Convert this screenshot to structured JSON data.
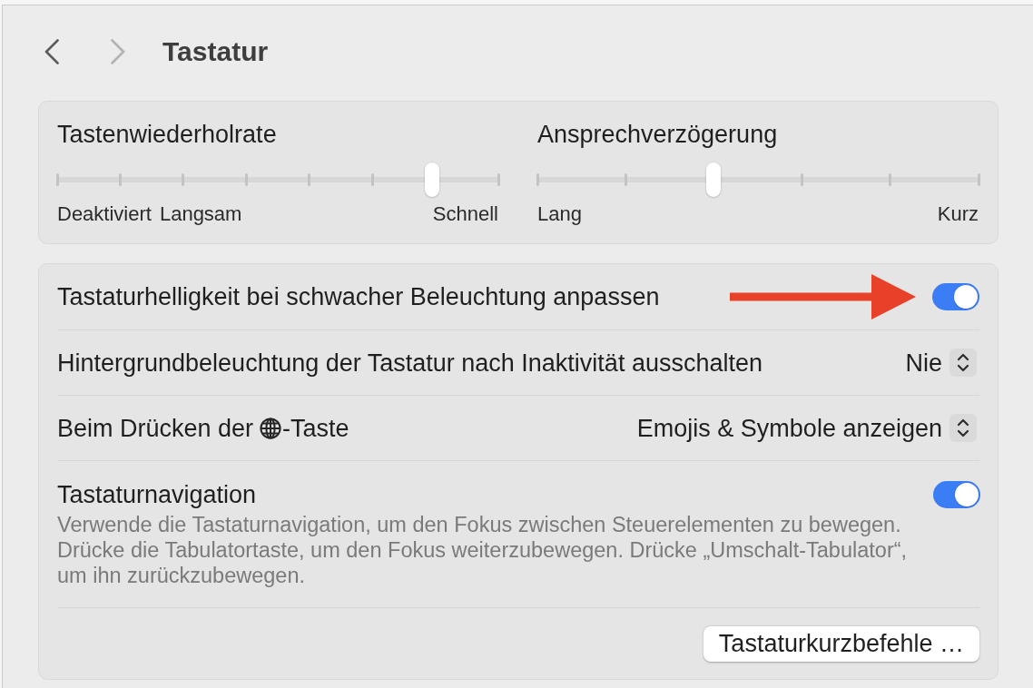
{
  "nav_buttons": [
    {
      "kind": "back",
      "disabled": false
    },
    {
      "kind": "forward",
      "disabled": true
    }
  ],
  "header": {
    "title": "Tastatur"
  },
  "sliders": [
    {
      "label": "Tastenwiederholrate",
      "level": 0.85,
      "min_labels": [
        "Deaktiviert",
        "Langsam"
      ],
      "max_labels": [
        "Schnell"
      ]
    },
    {
      "label": "Ansprechverzögerung",
      "level": 0.4,
      "min_labels": [
        "Lang"
      ],
      "max_labels": [
        "Kurz"
      ]
    }
  ],
  "settings": [
    {
      "kind": "toggle",
      "label": "Tastaturhelligkeit bei schwacher Beleuchtung anpassen",
      "on": true,
      "arrow_marker": true
    },
    {
      "kind": "popup",
      "label": "Hintergrundbeleuchtung der Tastatur nach Inaktivität ausschalten",
      "value": "Nie",
      "arrow_marker": false
    },
    {
      "kind": "popup",
      "label": "Beim Drücken der",
      "label_after_icon": "-Taste",
      "value": "Emojis & Symbole anzeigen",
      "arrow_marker": false
    },
    {
      "kind": "toggle",
      "label": "Tastaturnavigation",
      "description": "Verwende die Tastaturnavigation, um den Fokus zwischen Steuerelementen zu bewegen. Drücke die Tabulatortaste, um den Fokus weiterzubewegen. Drücke „Umschalt-Tabulator“, um ihn zurückzubewegen.",
      "on": true,
      "arrow_marker": false
    },
    {
      "kind": "button",
      "label": "Tastaturkurzbefehle …",
      "arrow_marker": false
    }
  ]
}
